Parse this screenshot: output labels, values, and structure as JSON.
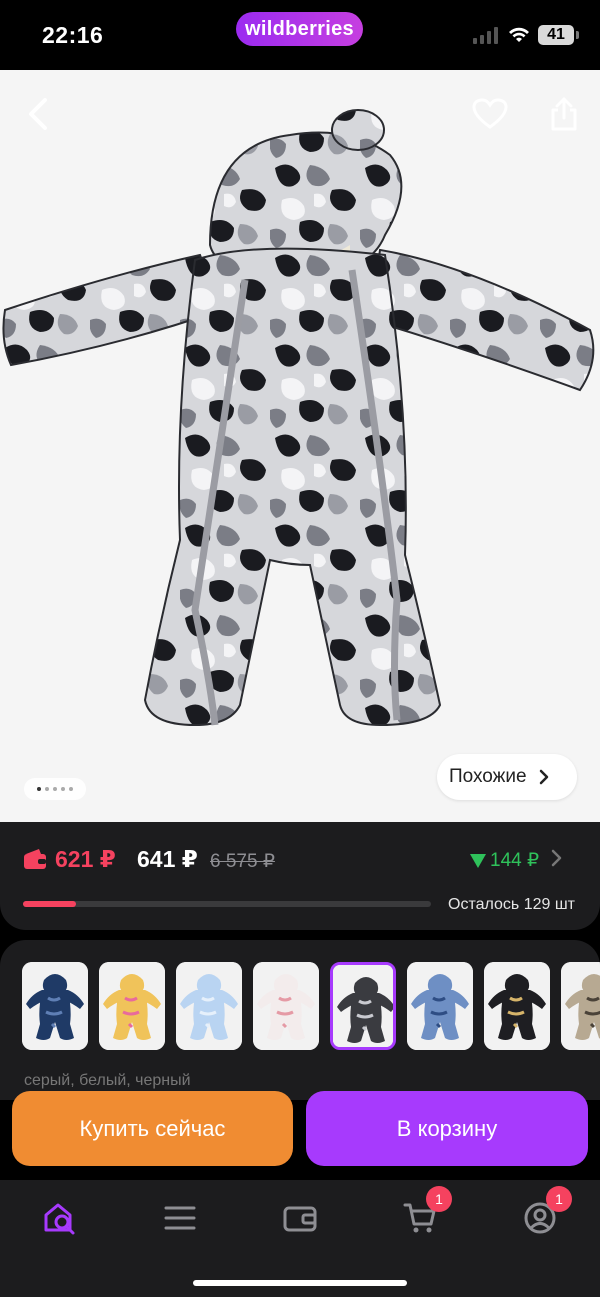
{
  "status_bar": {
    "time": "22:16",
    "battery": "41"
  },
  "brand": {
    "name": "wildberries"
  },
  "gallery": {
    "similar_label": "Похожие",
    "dot_count": 5,
    "active_dot": 0
  },
  "price": {
    "wallet_price": "621 ₽",
    "price": "641 ₽",
    "old_price": "6 575 ₽",
    "price_drop": "144 ₽",
    "stock_label": "Осталось 129 шт",
    "stock_fill_fraction": 0.13
  },
  "variants": {
    "selected_index": 4,
    "items": [
      {
        "name": "navy-print"
      },
      {
        "name": "multicolor-print"
      },
      {
        "name": "light-blue"
      },
      {
        "name": "white-floral"
      },
      {
        "name": "gray-camo"
      },
      {
        "name": "blue-glossy"
      },
      {
        "name": "black-leopard"
      },
      {
        "name": "beige-leopard"
      }
    ],
    "description_peek": "серый, белый, черный"
  },
  "actions": {
    "buy_now": "Купить сейчас",
    "add_to_cart": "В корзину"
  },
  "tabbar": {
    "cart_badge": "1",
    "profile_badge": "1"
  },
  "colors": {
    "accent": "#a73afd",
    "buy": "#f08c32",
    "price_red": "#f5425f",
    "drop_green": "#2fc25b"
  }
}
